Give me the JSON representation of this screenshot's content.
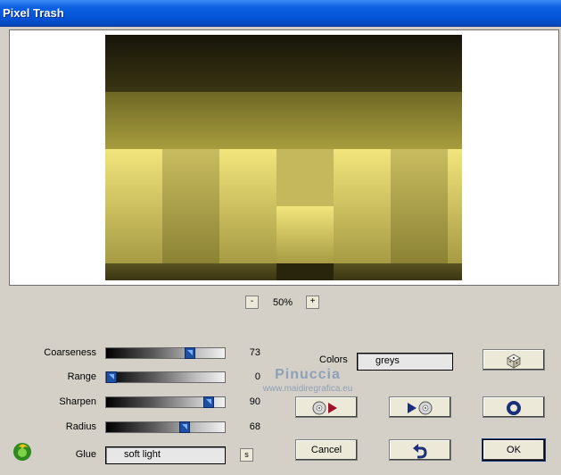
{
  "window": {
    "title": "Pixel Trash"
  },
  "zoom": {
    "level": "50%",
    "minus": "-",
    "plus": "+"
  },
  "sliders": [
    {
      "label": "Coarseness",
      "value": 73,
      "max": 100
    },
    {
      "label": "Range",
      "value": 0,
      "max": 100
    },
    {
      "label": "Sharpen",
      "value": 90,
      "max": 100
    },
    {
      "label": "Radius",
      "value": 68,
      "max": 100
    }
  ],
  "glue": {
    "label": "Glue",
    "value": "soft light",
    "button": "s"
  },
  "colors": {
    "label": "Colors",
    "value": "greys"
  },
  "buttons": {
    "cancel": "Cancel",
    "ok": "OK"
  },
  "watermark": {
    "line1": "Pinuccia",
    "line2": "www.maidiregrafica.eu"
  },
  "icons": {
    "random": "dice-icon",
    "reset": "circle-icon",
    "undo": "undo-arrow-icon",
    "play_left": "disc-play-icon",
    "play_right": "play-disc-icon",
    "logo": "plugin-logo-icon"
  }
}
